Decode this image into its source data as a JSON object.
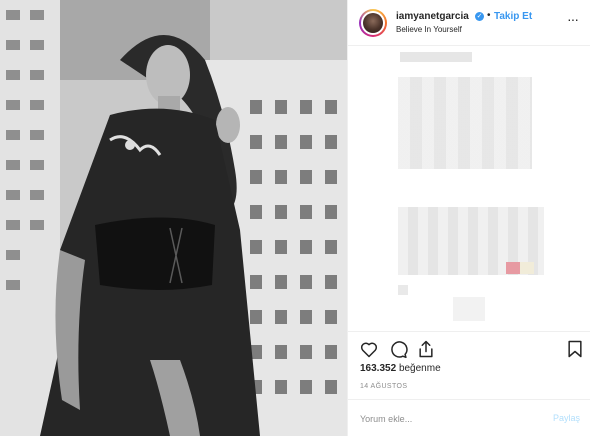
{
  "post": {
    "photo_icon": "portrait-photo",
    "header": {
      "username": "iamyanetgarcia",
      "verified_icon": "verified-badge-icon",
      "separator": "•",
      "follow_label": "Takip Et",
      "subtitle": "Believe In Yourself",
      "more_icon": "more-options-icon"
    },
    "actions": {
      "like_icon": "heart-icon",
      "comment_icon": "comment-icon",
      "share_icon": "share-icon",
      "save_icon": "bookmark-icon",
      "likes_count": "163.352",
      "likes_label": "beğenme",
      "date": "14 AĞUSTOS"
    },
    "comment_box": {
      "placeholder": "Yorum ekle...",
      "post_label": "Paylaş"
    },
    "colors": {
      "accent": "#3897f0",
      "text": "#262626",
      "muted": "#8e8e8e",
      "border": "#efefef",
      "post_disabled": "#b2dffc"
    }
  }
}
